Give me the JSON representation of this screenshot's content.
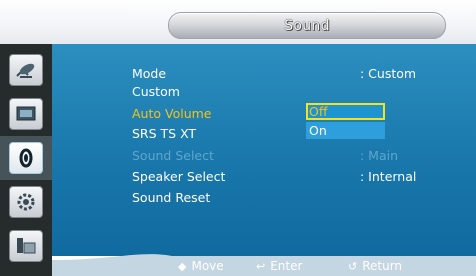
{
  "title": "Sound",
  "sidebar": {
    "items": [
      {
        "icon": "satellite-dish-icon"
      },
      {
        "icon": "picture-icon"
      },
      {
        "icon": "sound-icon",
        "active": true
      },
      {
        "icon": "gear-icon"
      },
      {
        "icon": "multi-screen-icon"
      }
    ]
  },
  "menu": {
    "rows": [
      {
        "label": "Mode",
        "value": ": Custom",
        "state": "normal"
      },
      {
        "label": "Custom",
        "value": "",
        "state": "normal"
      },
      {
        "label": "Auto Volume",
        "value": ":",
        "state": "highlight"
      },
      {
        "label": "SRS TS XT",
        "value": ":",
        "state": "normal"
      },
      {
        "label": "Sound Select",
        "value": ": Main",
        "state": "dim"
      },
      {
        "label": "Speaker Select",
        "value": ": Internal",
        "state": "normal"
      },
      {
        "label": "Sound Reset",
        "value": "",
        "state": "normal"
      }
    ],
    "dropdown": {
      "options": [
        "Off",
        "On"
      ],
      "selected": "Off"
    }
  },
  "footer": {
    "move": "Move",
    "enter": "Enter",
    "return": "Return"
  },
  "colors": {
    "panel": "#1977ab",
    "highlight": "#f2c31b",
    "dim_text": "#5fa6cc",
    "sidebar": "#262c2c"
  }
}
